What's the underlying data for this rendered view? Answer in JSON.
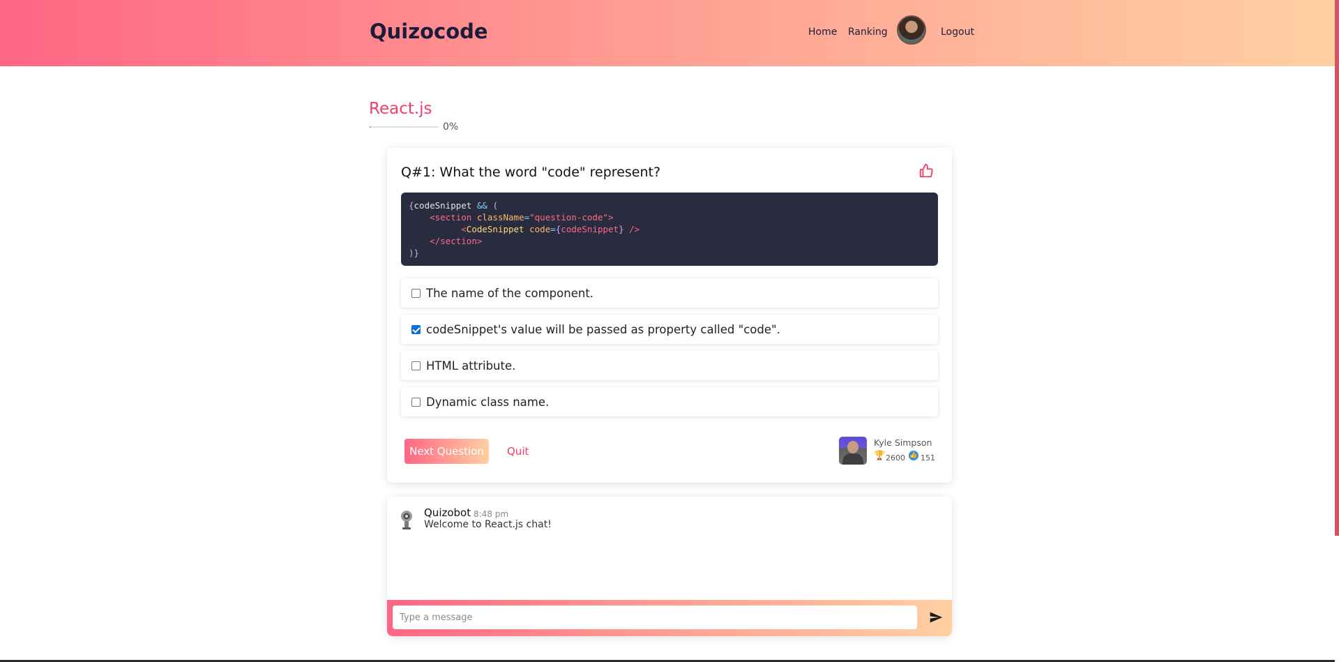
{
  "header": {
    "brand": "Quizocode",
    "nav": {
      "home": "Home",
      "ranking": "Ranking",
      "logout": "Logout"
    }
  },
  "quiz": {
    "title": "React.js",
    "progress_percent": 0,
    "progress_label": "0%"
  },
  "question": {
    "title": "Q#1: What the word \"code\" represent?",
    "options": [
      {
        "label": "The name of the component.",
        "checked": false
      },
      {
        "label": "codeSnippet's value will be passed as property called \"code\".",
        "checked": true
      },
      {
        "label": "HTML attribute.",
        "checked": false
      },
      {
        "label": "Dynamic class name.",
        "checked": false
      }
    ],
    "next_label": "Next Question",
    "quit_label": "Quit"
  },
  "author": {
    "name": "Kyle Simpson",
    "trophies": "2600",
    "likes": "151"
  },
  "chat": {
    "messages": [
      {
        "name": "Quizobot",
        "time": "8:48 pm",
        "text": "Welcome to React.js chat!"
      }
    ],
    "input_placeholder": "Type a message"
  },
  "colors": {
    "accent": "#f43d65",
    "gradient_start": "#ff6684",
    "gradient_end": "#ffd0a2",
    "code_bg": "#282c3e"
  },
  "icons": {
    "like": "thumbs-up-icon",
    "send": "send-icon",
    "trophy": "trophy-icon",
    "likes": "like-badge-icon"
  }
}
